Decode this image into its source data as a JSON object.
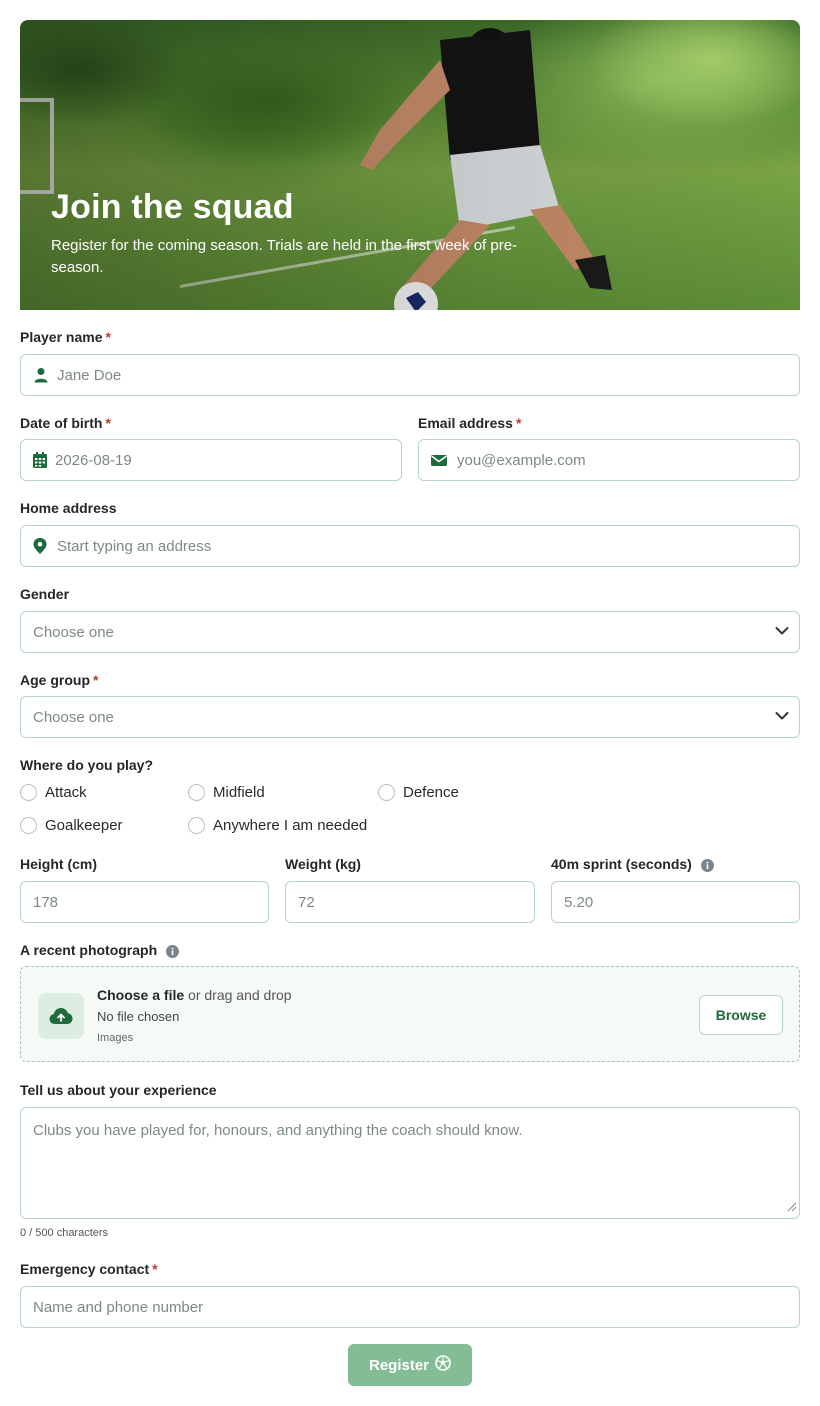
{
  "hero": {
    "title": "Join the squad",
    "subtitle": "Register for the coming season. Trials are held in the first week of pre-season."
  },
  "player_name": {
    "label": "Player name",
    "required_mark": "*",
    "placeholder": "Jane Doe",
    "icon": "user-icon"
  },
  "date_of_birth": {
    "label": "Date of birth",
    "required_mark": "*",
    "placeholder": "2026-08-19",
    "icon": "calendar-icon"
  },
  "email": {
    "label": "Email address",
    "required_mark": "*",
    "placeholder": "you@example.com",
    "icon": "envelope-icon"
  },
  "home_address": {
    "label": "Home address",
    "placeholder": "Start typing an address",
    "icon": "map-pin-icon"
  },
  "gender": {
    "label": "Gender",
    "selected": "Choose one"
  },
  "age_group": {
    "label": "Age group",
    "required_mark": "*",
    "selected": "Choose one"
  },
  "position": {
    "label": "Where do you play?",
    "options": [
      "Attack",
      "Midfield",
      "Defence",
      "Goalkeeper",
      "Anywhere I am needed"
    ]
  },
  "height": {
    "label": "Height (cm)",
    "placeholder": "178"
  },
  "weight": {
    "label": "Weight (kg)",
    "placeholder": "72"
  },
  "sprint": {
    "label": "40m sprint (seconds)",
    "placeholder": "5.20"
  },
  "photo": {
    "label": "A recent photograph",
    "choose": "Choose a file",
    "drag": "or drag and drop",
    "status": "No file chosen",
    "types": "Images",
    "browse_label": "Browse"
  },
  "experience": {
    "label": "Tell us about your experience",
    "placeholder": "Clubs you have played for, honours, and anything the coach should know.",
    "counter": "0 / 500 characters"
  },
  "emergency": {
    "label": "Emergency contact",
    "required_mark": "*",
    "placeholder": "Name and phone number"
  },
  "submit": {
    "label": "Register",
    "icon": "football-icon"
  },
  "colors": {
    "accent": "#1d6b3b",
    "button": "#82bd95",
    "border": "#b9d4c4",
    "required": "#c0392b"
  }
}
